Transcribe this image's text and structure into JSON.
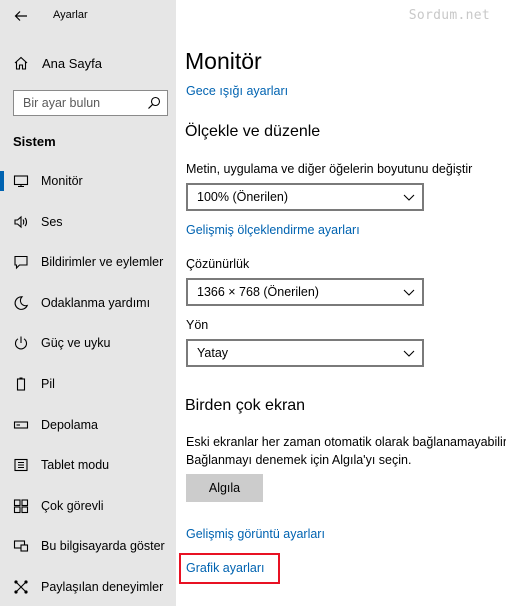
{
  "window": {
    "title": "Ayarlar",
    "watermark": "Sordum.net"
  },
  "sidebar": {
    "home_label": "Ana Sayfa",
    "search_placeholder": "Bir ayar bulun",
    "section": "Sistem",
    "items": [
      {
        "label": "Monitör",
        "icon": "monitor-icon",
        "active": true
      },
      {
        "label": "Ses",
        "icon": "speaker-icon"
      },
      {
        "label": "Bildirimler ve eylemler",
        "icon": "notification-icon"
      },
      {
        "label": "Odaklanma yardımı",
        "icon": "moon-icon"
      },
      {
        "label": "Güç ve uyku",
        "icon": "power-icon"
      },
      {
        "label": "Pil",
        "icon": "battery-icon"
      },
      {
        "label": "Depolama",
        "icon": "storage-icon"
      },
      {
        "label": "Tablet modu",
        "icon": "tablet-icon"
      },
      {
        "label": "Çok görevli",
        "icon": "multitask-icon"
      },
      {
        "label": "Bu bilgisayarda göster",
        "icon": "project-icon"
      },
      {
        "label": "Paylaşılan deneyimler",
        "icon": "share-icon"
      }
    ]
  },
  "main": {
    "title": "Monitör",
    "night_light_link": "Gece ışığı ayarları",
    "scale_heading": "Ölçekle ve düzenle",
    "scale_label": "Metin, uygulama ve diğer öğelerin boyutunu değiştir",
    "scale_value": "100% (Önerilen)",
    "advanced_scaling_link": "Gelişmiş ölçeklendirme ayarları",
    "resolution_label": "Çözünürlük",
    "resolution_value": "1366 × 768 (Önerilen)",
    "orientation_label": "Yön",
    "orientation_value": "Yatay",
    "multi_heading": "Birden çok ekran",
    "multi_desc_1": "Eski ekranlar her zaman otomatik olarak bağlanamayabilir.",
    "multi_desc_2": "Bağlanmayı denemek için Algıla'yı seçin.",
    "detect_button": "Algıla",
    "advanced_display_link": "Gelişmiş görüntü ayarları",
    "graphics_link": "Grafik ayarları"
  },
  "colors": {
    "accent": "#0063b1",
    "sidebar_bg": "#e6e6e6",
    "highlight": "#e81123"
  }
}
